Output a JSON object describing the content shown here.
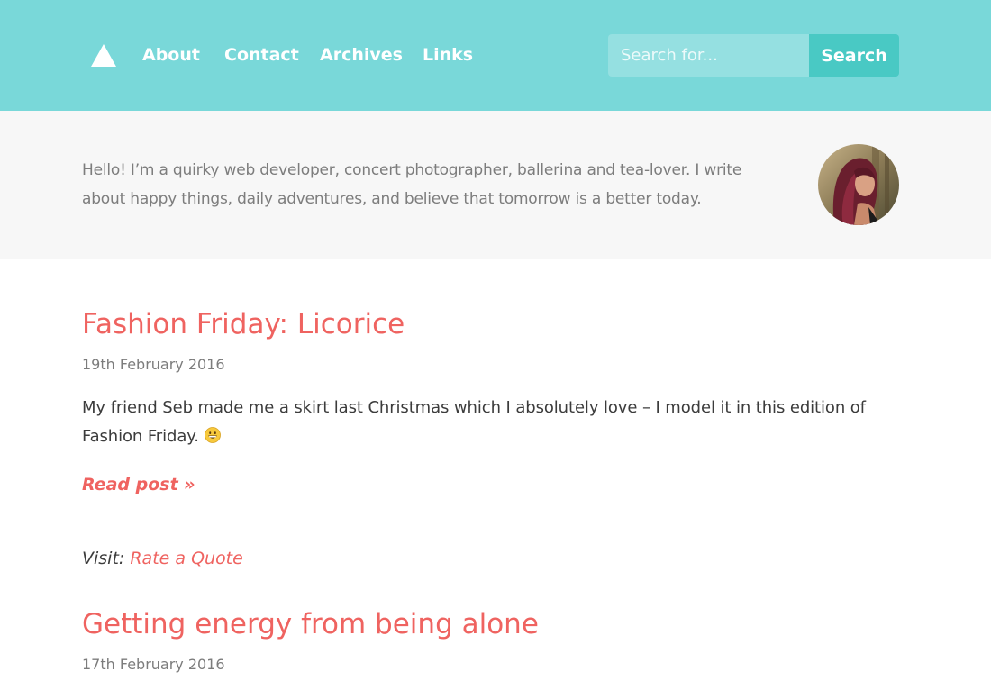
{
  "header": {
    "nav": [
      {
        "label": "About"
      },
      {
        "label": "Contact"
      },
      {
        "label": "Archives"
      },
      {
        "label": "Links"
      }
    ],
    "search": {
      "placeholder": "Search for...",
      "button_label": "Search"
    },
    "logo_icon": "triangle-logo-icon"
  },
  "intro": {
    "text": "Hello! I’m a quirky web developer, concert photographer, ballerina and tea-lover. I write about happy things, daily adventures, and believe that tomorrow is a better today.",
    "avatar_icon": "avatar-photo"
  },
  "posts": [
    {
      "title": "Fashion Friday: Licorice",
      "date": "19th February 2016",
      "excerpt": "My friend Seb made me a skirt last Christmas which I absolutely love – I model it in this edition of Fashion Friday.",
      "emoji_icon": "grinning-emoji-icon",
      "read_more": "Read post »"
    },
    {
      "title": "Getting energy from being alone",
      "date": "17th February 2016"
    }
  ],
  "visit": {
    "prefix": "Visit:",
    "link_label": "Rate a Quote"
  },
  "colors": {
    "header_bg": "#79d8d9",
    "search_button": "#49c9c4",
    "accent": "#ef6360",
    "intro_bg": "#f7f7f7"
  }
}
